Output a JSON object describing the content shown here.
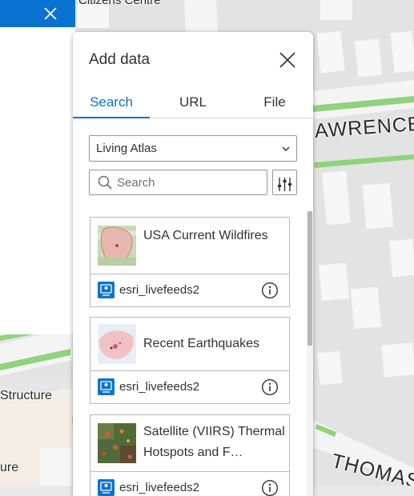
{
  "map": {
    "labels": {
      "centre": "Citizens Centre",
      "lawrence": "AWRENCE S",
      "thomas": "THOMAS",
      "structure": "Structure",
      "ure": "ure"
    }
  },
  "left_panel": {
    "close_icon": "close-icon"
  },
  "panel": {
    "title": "Add data",
    "close_icon": "close-icon",
    "tabs": [
      {
        "label": "Search",
        "active": true
      },
      {
        "label": "URL",
        "active": false
      },
      {
        "label": "File",
        "active": false
      }
    ],
    "source_select": {
      "value": "Living Atlas",
      "icon": "chevron-down-icon"
    },
    "search": {
      "placeholder": "Search",
      "value": "",
      "icon": "search-icon",
      "filter_icon": "sliders-icon"
    },
    "results": [
      {
        "title": "USA Current Wildfires",
        "owner": "esri_livefeeds2",
        "thumb": "wildfire-map",
        "info_icon": "info-icon"
      },
      {
        "title": "Recent Earthquakes",
        "owner": "esri_livefeeds2",
        "thumb": "earthquake-map",
        "info_icon": "info-icon"
      },
      {
        "title": "Satellite (VIIRS) Thermal Hotspots and F…",
        "owner": "esri_livefeeds2",
        "thumb": "hotspots-map",
        "info_icon": "info-icon"
      }
    ]
  },
  "colors": {
    "accent": "#0a73d1",
    "map_green": "#8fd37a",
    "building": "#f7f7f7"
  }
}
